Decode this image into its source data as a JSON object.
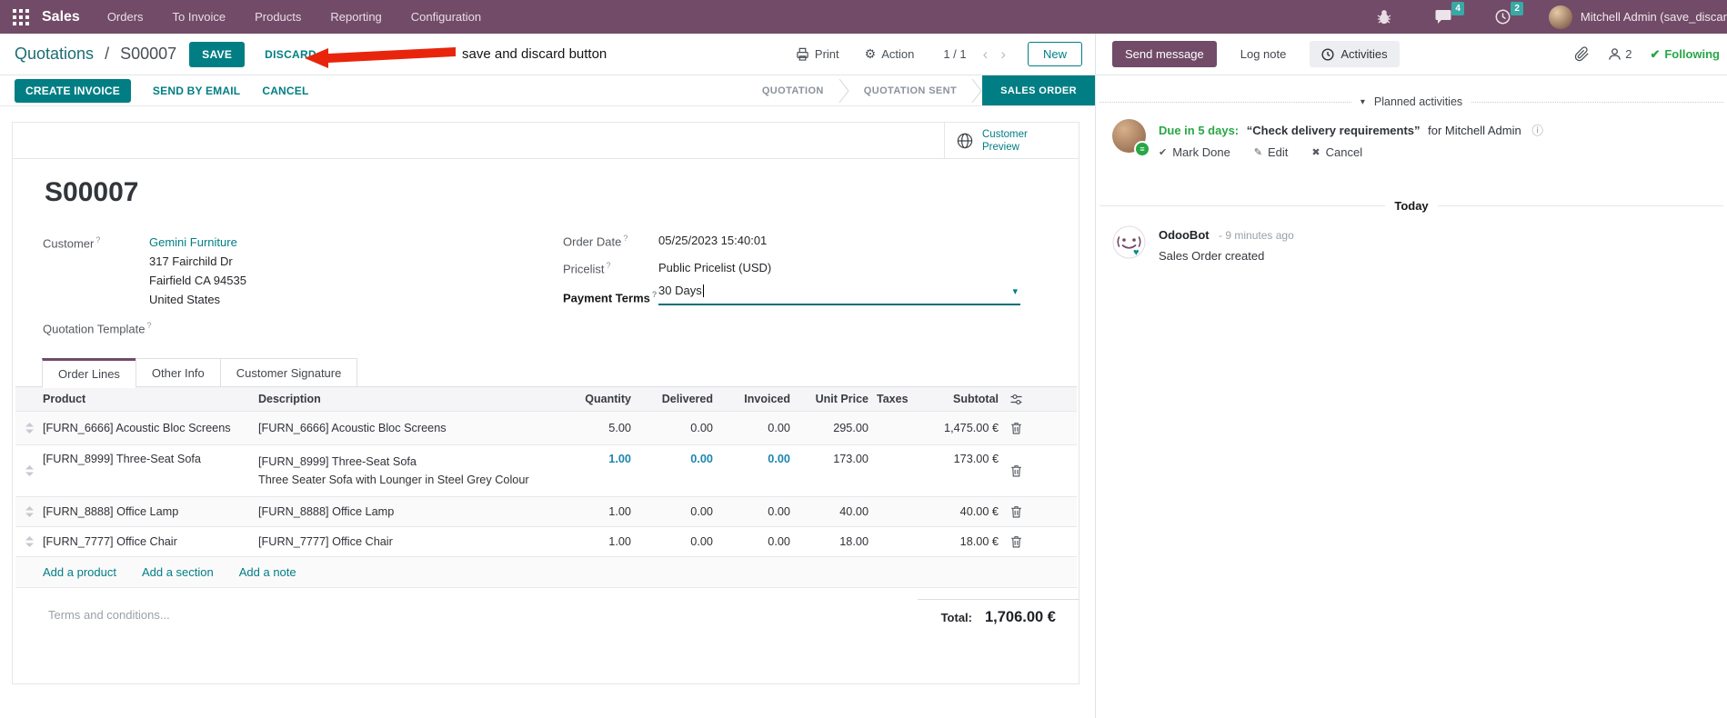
{
  "colors": {
    "navbar_bg": "#714B67",
    "primary_teal": "#017E84",
    "success_green": "#28a745",
    "annotation_arrow_red": "#e8250c",
    "modified_field_blue": "#1d86ad",
    "badge_teal": "#3aa8a5"
  },
  "navbar": {
    "app_name": "Sales",
    "menus": [
      "Orders",
      "To Invoice",
      "Products",
      "Reporting",
      "Configuration"
    ],
    "messages_badge": "4",
    "activities_badge": "2",
    "user_name": "Mitchell Admin (save_discar"
  },
  "control_panel": {
    "breadcrumb_parent": "Quotations",
    "breadcrumb_separator": "/",
    "breadcrumb_current": "S00007",
    "save": "SAVE",
    "discard": "DISCARD",
    "annotation": "save and discard button",
    "print": "Print",
    "gear_glyph": "⚙",
    "action": "Action",
    "pager": "1 / 1",
    "prev_glyph": "‹",
    "next_glyph": "›",
    "new": "New"
  },
  "action_bar": {
    "create_invoice": "CREATE INVOICE",
    "send_by_email": "SEND BY EMAIL",
    "cancel": "CANCEL",
    "statusbar": [
      {
        "label": "QUOTATION"
      },
      {
        "label": "QUOTATION SENT"
      },
      {
        "label": "SALES ORDER"
      }
    ]
  },
  "sheet": {
    "customer_preview_line1": "Customer",
    "customer_preview_line2": "Preview",
    "title": "S00007",
    "help_marker": "?",
    "customer_label": "Customer",
    "customer_name": "Gemini Furniture",
    "address_line1": "317 Fairchild Dr",
    "address_line2": "Fairfield CA 94535",
    "address_line3": "United States",
    "quotation_template_label": "Quotation Template",
    "order_date_label": "Order Date",
    "order_date_value": "05/25/2023 15:40:01",
    "pricelist_label": "Pricelist",
    "pricelist_value": "Public Pricelist (USD)",
    "payment_terms_label": "Payment Terms",
    "payment_terms_value": "30 Days",
    "dropdown_caret": "▾",
    "tabs": [
      "Order Lines",
      "Other Info",
      "Customer Signature"
    ],
    "table": {
      "headers": [
        "Product",
        "Description",
        "Quantity",
        "Delivered",
        "Invoiced",
        "Unit Price",
        "Taxes",
        "Subtotal"
      ],
      "rows": [
        {
          "product": "[FURN_6666] Acoustic Bloc Screens",
          "description": "[FURN_6666] Acoustic Bloc Screens",
          "quantity": "5.00",
          "delivered": "0.00",
          "invoiced": "0.00",
          "unit_price": "295.00",
          "subtotal": "1,475.00 €"
        },
        {
          "product": "[FURN_8999] Three-Seat Sofa",
          "description": "[FURN_8999] Three-Seat Sofa",
          "description2": "Three Seater Sofa with Lounger in Steel Grey Colour",
          "quantity": "1.00",
          "delivered": "0.00",
          "invoiced": "0.00",
          "unit_price": "173.00",
          "subtotal": "173.00 €"
        },
        {
          "product": "[FURN_8888] Office Lamp",
          "description": "[FURN_8888] Office Lamp",
          "quantity": "1.00",
          "delivered": "0.00",
          "invoiced": "0.00",
          "unit_price": "40.00",
          "subtotal": "40.00 €"
        },
        {
          "product": "[FURN_7777] Office Chair",
          "description": "[FURN_7777] Office Chair",
          "quantity": "1.00",
          "delivered": "0.00",
          "invoiced": "0.00",
          "unit_price": "18.00",
          "subtotal": "18.00 €"
        }
      ],
      "footer_links": [
        "Add a product",
        "Add a section",
        "Add a note"
      ]
    },
    "terms_placeholder": "Terms and conditions...",
    "total_label": "Total:",
    "total_value": "1,706.00 €"
  },
  "chatter": {
    "send_message": "Send message",
    "log_note": "Log note",
    "activities": "Activities",
    "followers_count": "2",
    "following": "Following",
    "planned_caret": "▾",
    "planned_activities": "Planned activities",
    "activity": {
      "due": "Due in 5 days:",
      "summary": "“Check delivery requirements”",
      "assignee": "for Mitchell Admin",
      "info_glyph": "ⓘ",
      "badge_glyph": "≡",
      "check_glyph": "✔",
      "mark_done": "Mark Done",
      "edit_glyph": "✎",
      "edit": "Edit",
      "cancel_glyph": "✖",
      "cancel": "Cancel"
    },
    "today": "Today",
    "message": {
      "author": "OdooBot",
      "time": "- 9 minutes ago",
      "body": "Sales Order created"
    }
  }
}
